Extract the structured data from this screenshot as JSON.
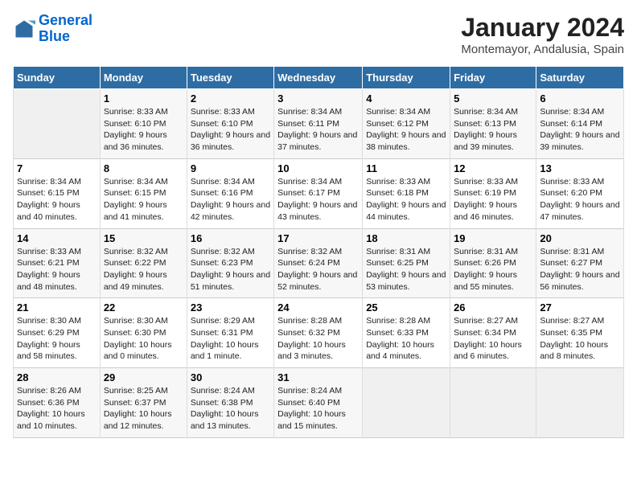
{
  "header": {
    "logo_line1": "General",
    "logo_line2": "Blue",
    "month_year": "January 2024",
    "location": "Montemayor, Andalusia, Spain"
  },
  "days_of_week": [
    "Sunday",
    "Monday",
    "Tuesday",
    "Wednesday",
    "Thursday",
    "Friday",
    "Saturday"
  ],
  "weeks": [
    [
      {
        "num": "",
        "sunrise": "",
        "sunset": "",
        "daylight": ""
      },
      {
        "num": "1",
        "sunrise": "Sunrise: 8:33 AM",
        "sunset": "Sunset: 6:10 PM",
        "daylight": "Daylight: 9 hours and 36 minutes."
      },
      {
        "num": "2",
        "sunrise": "Sunrise: 8:33 AM",
        "sunset": "Sunset: 6:10 PM",
        "daylight": "Daylight: 9 hours and 36 minutes."
      },
      {
        "num": "3",
        "sunrise": "Sunrise: 8:34 AM",
        "sunset": "Sunset: 6:11 PM",
        "daylight": "Daylight: 9 hours and 37 minutes."
      },
      {
        "num": "4",
        "sunrise": "Sunrise: 8:34 AM",
        "sunset": "Sunset: 6:12 PM",
        "daylight": "Daylight: 9 hours and 38 minutes."
      },
      {
        "num": "5",
        "sunrise": "Sunrise: 8:34 AM",
        "sunset": "Sunset: 6:13 PM",
        "daylight": "Daylight: 9 hours and 39 minutes."
      },
      {
        "num": "6",
        "sunrise": "Sunrise: 8:34 AM",
        "sunset": "Sunset: 6:14 PM",
        "daylight": "Daylight: 9 hours and 39 minutes."
      }
    ],
    [
      {
        "num": "7",
        "sunrise": "Sunrise: 8:34 AM",
        "sunset": "Sunset: 6:15 PM",
        "daylight": "Daylight: 9 hours and 40 minutes."
      },
      {
        "num": "8",
        "sunrise": "Sunrise: 8:34 AM",
        "sunset": "Sunset: 6:15 PM",
        "daylight": "Daylight: 9 hours and 41 minutes."
      },
      {
        "num": "9",
        "sunrise": "Sunrise: 8:34 AM",
        "sunset": "Sunset: 6:16 PM",
        "daylight": "Daylight: 9 hours and 42 minutes."
      },
      {
        "num": "10",
        "sunrise": "Sunrise: 8:34 AM",
        "sunset": "Sunset: 6:17 PM",
        "daylight": "Daylight: 9 hours and 43 minutes."
      },
      {
        "num": "11",
        "sunrise": "Sunrise: 8:33 AM",
        "sunset": "Sunset: 6:18 PM",
        "daylight": "Daylight: 9 hours and 44 minutes."
      },
      {
        "num": "12",
        "sunrise": "Sunrise: 8:33 AM",
        "sunset": "Sunset: 6:19 PM",
        "daylight": "Daylight: 9 hours and 46 minutes."
      },
      {
        "num": "13",
        "sunrise": "Sunrise: 8:33 AM",
        "sunset": "Sunset: 6:20 PM",
        "daylight": "Daylight: 9 hours and 47 minutes."
      }
    ],
    [
      {
        "num": "14",
        "sunrise": "Sunrise: 8:33 AM",
        "sunset": "Sunset: 6:21 PM",
        "daylight": "Daylight: 9 hours and 48 minutes."
      },
      {
        "num": "15",
        "sunrise": "Sunrise: 8:32 AM",
        "sunset": "Sunset: 6:22 PM",
        "daylight": "Daylight: 9 hours and 49 minutes."
      },
      {
        "num": "16",
        "sunrise": "Sunrise: 8:32 AM",
        "sunset": "Sunset: 6:23 PM",
        "daylight": "Daylight: 9 hours and 51 minutes."
      },
      {
        "num": "17",
        "sunrise": "Sunrise: 8:32 AM",
        "sunset": "Sunset: 6:24 PM",
        "daylight": "Daylight: 9 hours and 52 minutes."
      },
      {
        "num": "18",
        "sunrise": "Sunrise: 8:31 AM",
        "sunset": "Sunset: 6:25 PM",
        "daylight": "Daylight: 9 hours and 53 minutes."
      },
      {
        "num": "19",
        "sunrise": "Sunrise: 8:31 AM",
        "sunset": "Sunset: 6:26 PM",
        "daylight": "Daylight: 9 hours and 55 minutes."
      },
      {
        "num": "20",
        "sunrise": "Sunrise: 8:31 AM",
        "sunset": "Sunset: 6:27 PM",
        "daylight": "Daylight: 9 hours and 56 minutes."
      }
    ],
    [
      {
        "num": "21",
        "sunrise": "Sunrise: 8:30 AM",
        "sunset": "Sunset: 6:29 PM",
        "daylight": "Daylight: 9 hours and 58 minutes."
      },
      {
        "num": "22",
        "sunrise": "Sunrise: 8:30 AM",
        "sunset": "Sunset: 6:30 PM",
        "daylight": "Daylight: 10 hours and 0 minutes."
      },
      {
        "num": "23",
        "sunrise": "Sunrise: 8:29 AM",
        "sunset": "Sunset: 6:31 PM",
        "daylight": "Daylight: 10 hours and 1 minute."
      },
      {
        "num": "24",
        "sunrise": "Sunrise: 8:28 AM",
        "sunset": "Sunset: 6:32 PM",
        "daylight": "Daylight: 10 hours and 3 minutes."
      },
      {
        "num": "25",
        "sunrise": "Sunrise: 8:28 AM",
        "sunset": "Sunset: 6:33 PM",
        "daylight": "Daylight: 10 hours and 4 minutes."
      },
      {
        "num": "26",
        "sunrise": "Sunrise: 8:27 AM",
        "sunset": "Sunset: 6:34 PM",
        "daylight": "Daylight: 10 hours and 6 minutes."
      },
      {
        "num": "27",
        "sunrise": "Sunrise: 8:27 AM",
        "sunset": "Sunset: 6:35 PM",
        "daylight": "Daylight: 10 hours and 8 minutes."
      }
    ],
    [
      {
        "num": "28",
        "sunrise": "Sunrise: 8:26 AM",
        "sunset": "Sunset: 6:36 PM",
        "daylight": "Daylight: 10 hours and 10 minutes."
      },
      {
        "num": "29",
        "sunrise": "Sunrise: 8:25 AM",
        "sunset": "Sunset: 6:37 PM",
        "daylight": "Daylight: 10 hours and 12 minutes."
      },
      {
        "num": "30",
        "sunrise": "Sunrise: 8:24 AM",
        "sunset": "Sunset: 6:38 PM",
        "daylight": "Daylight: 10 hours and 13 minutes."
      },
      {
        "num": "31",
        "sunrise": "Sunrise: 8:24 AM",
        "sunset": "Sunset: 6:40 PM",
        "daylight": "Daylight: 10 hours and 15 minutes."
      },
      {
        "num": "",
        "sunrise": "",
        "sunset": "",
        "daylight": ""
      },
      {
        "num": "",
        "sunrise": "",
        "sunset": "",
        "daylight": ""
      },
      {
        "num": "",
        "sunrise": "",
        "sunset": "",
        "daylight": ""
      }
    ]
  ]
}
